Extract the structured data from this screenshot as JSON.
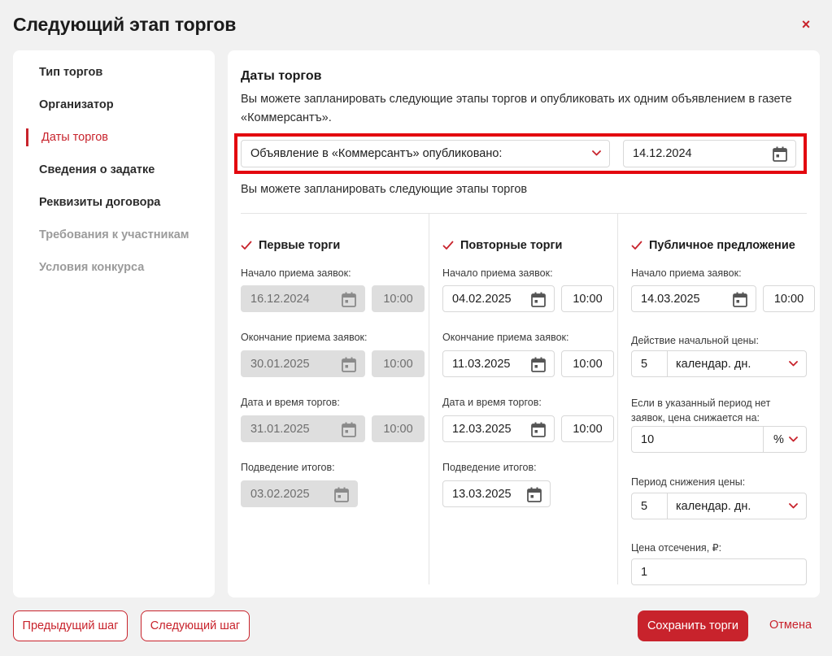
{
  "modal": {
    "title": "Следующий этап торгов",
    "close": "×"
  },
  "sidebar": {
    "items": [
      {
        "label": "Тип торгов"
      },
      {
        "label": "Организатор"
      },
      {
        "label": "Даты торгов"
      },
      {
        "label": "Сведения о задатке"
      },
      {
        "label": "Реквизиты договора"
      },
      {
        "label": "Требования к участникам"
      },
      {
        "label": "Условия конкурса"
      }
    ],
    "active_index": 2
  },
  "main": {
    "title": "Даты торгов",
    "description": "Вы можете запланировать следующие этапы торгов и опубликовать их одним объявлением в газете «Коммерсантъ».",
    "publication": {
      "select_value": "Объявление в «Коммерсантъ» опубликовано:",
      "date": "14.12.2024"
    },
    "subtitle": "Вы можете запланировать следующие этапы торгов",
    "columns": {
      "first": {
        "title": "Первые торги",
        "label_start": "Начало приема заявок:",
        "start_date": "16.12.2024",
        "start_time": "10:00",
        "label_end": "Окончание приема заявок:",
        "end_date": "30.01.2025",
        "end_time": "10:00",
        "label_auction": "Дата и время торгов:",
        "auction_date": "31.01.2025",
        "auction_time": "10:00",
        "label_results": "Подведение итогов:",
        "results_date": "03.02.2025"
      },
      "repeat": {
        "title": "Повторные торги",
        "label_start": "Начало приема заявок:",
        "start_date": "04.02.2025",
        "start_time": "10:00",
        "label_end": "Окончание приема заявок:",
        "end_date": "11.03.2025",
        "end_time": "10:00",
        "label_auction": "Дата и время торгов:",
        "auction_date": "12.03.2025",
        "auction_time": "10:00",
        "label_results": "Подведение итогов:",
        "results_date": "13.03.2025"
      },
      "public": {
        "title": "Публичное предложение",
        "label_start": "Начало приема заявок:",
        "start_date": "14.03.2025",
        "start_time": "10:00",
        "label_price_duration": "Действие начальной цены:",
        "price_duration_value": "5",
        "price_duration_unit": "календар. дн.",
        "label_reduction": "Если в указанный период нет заявок, цена снижается на:",
        "reduction_value": "10",
        "reduction_unit": "%",
        "label_reduction_period": "Период снижения цены:",
        "reduction_period_value": "5",
        "reduction_period_unit": "календар. дн.",
        "label_cutoff": "Цена отсечения, ₽:",
        "cutoff_value": "1"
      }
    }
  },
  "footer": {
    "prev": "Предыдущий шаг",
    "next": "Следующий шаг",
    "save": "Сохранить торги",
    "cancel": "Отмена"
  },
  "colors": {
    "accent": "#c8232c",
    "highlight": "#e3080f"
  }
}
